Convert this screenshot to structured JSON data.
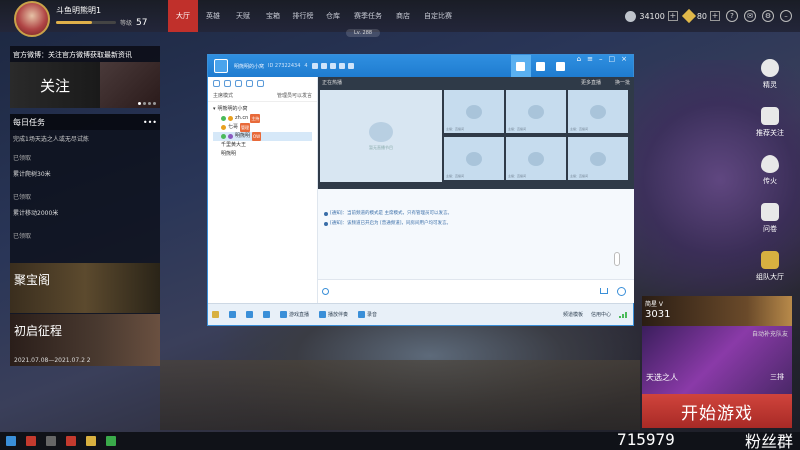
{
  "user": {
    "name": "斗鱼明熊明1",
    "level_label": "等级",
    "level": "57",
    "level_progress": 0.6
  },
  "nav": [
    "大厅",
    "英雄",
    "天赋",
    "宝箱",
    "排行榜",
    "仓库",
    "赛季任务",
    "商店",
    "自定比赛"
  ],
  "resources": {
    "coins": "34100",
    "gems": "80"
  },
  "lv_tag": "Lv. 288",
  "weibo": {
    "title": "官方微博：关注官方微博获取最新资讯",
    "banner_text": "关注"
  },
  "daily": {
    "title": "每日任务",
    "more": "•••",
    "subtitle": "完成1场天选之人或无尽试炼",
    "tasks": [
      {
        "status": "已领取",
        "text": "累计爬树30米"
      },
      {
        "status": "已领取",
        "text": "累计移动2000米"
      },
      {
        "status": "已领取",
        "text": ""
      }
    ]
  },
  "cards": {
    "jbg": "聚宝阁",
    "cq": "初启征程",
    "cq_date": "2021.07.08—2021.07.2 2"
  },
  "right_menu": [
    "精灵",
    "推荐关注",
    "传火",
    "问卷",
    "组队大厅"
  ],
  "rank": {
    "label": "简星 V",
    "value": "3031"
  },
  "tiantai": {
    "name": "天选之人",
    "mode": "三排",
    "auto": "自动补充队友"
  },
  "start_button": "开始游戏",
  "overlay": {
    "number": "715979",
    "fans": "粉丝群"
  },
  "chat": {
    "title": "明熊明的小窝",
    "id": "ID 27322434",
    "online": "4",
    "mode": "主席模式",
    "admin": "管理员可以发言",
    "tree": [
      {
        "label": "明熊明的小窝",
        "level": 0
      },
      {
        "label": "zh.cn",
        "level": 1,
        "tag": "主持"
      },
      {
        "label": "七哥",
        "level": 1,
        "tag": "管理"
      },
      {
        "label": "明熊明",
        "level": 1,
        "tag": "OW",
        "selected": true
      },
      {
        "label": "千里黄大王",
        "level": 1
      },
      {
        "label": "明熊明",
        "level": 1
      }
    ],
    "hot_title": "正在热播",
    "hot_more": "更多直播",
    "hot_next": "换一批",
    "hot_big_caption": "暂无直播节目",
    "hot_thumb_caption": "主播：直播间",
    "messages": [
      "[通知]：当前频道的模式是 主席模式，只有管理员可以发言。",
      "[通知]：该频道已开启为 [普通频道]，同房间用户均可发言。"
    ],
    "bottom": [
      "游戏直播",
      "播放伴奏",
      "录音"
    ],
    "status_mode": "频道模板",
    "status_center": "信用中心"
  }
}
